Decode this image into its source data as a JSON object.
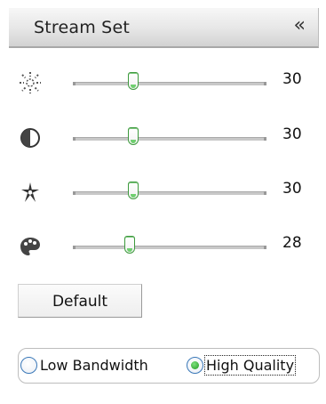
{
  "header": {
    "title": "Stream Set",
    "collapse_icon": "«"
  },
  "sliders": [
    {
      "name": "brightness",
      "icon": "brightness-icon",
      "value": "30",
      "level": 0.3
    },
    {
      "name": "contrast",
      "icon": "contrast-icon",
      "value": "30",
      "level": 0.3
    },
    {
      "name": "saturation",
      "icon": "saturation-icon",
      "value": "30",
      "level": 0.3
    },
    {
      "name": "hue",
      "icon": "hue-icon",
      "value": "28",
      "level": 0.28
    }
  ],
  "default_button": {
    "label": "Default"
  },
  "mode": {
    "options": [
      {
        "label": "Low Bandwidth",
        "checked": false
      },
      {
        "label": "High Quality",
        "checked": true
      }
    ]
  },
  "colors": {
    "thumb_accent": "#3d9a3d",
    "radio_border": "#3a78b8"
  }
}
